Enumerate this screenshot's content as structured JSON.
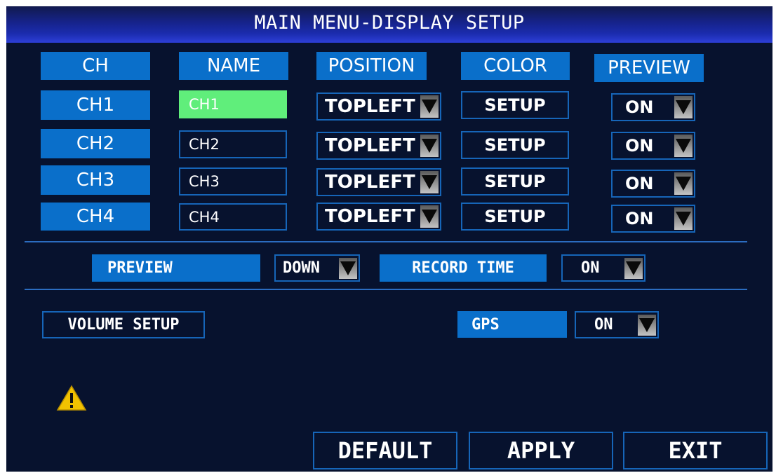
{
  "title": "MAIN MENU-DISPLAY SETUP",
  "headers": {
    "ch": "CH",
    "name": "NAME",
    "position": "POSITION",
    "color": "COLOR",
    "preview": "PREVIEW"
  },
  "channels": [
    {
      "label": "CH1",
      "name": "CH1",
      "position": "TOPLEFT",
      "color": "SETUP",
      "preview": "ON"
    },
    {
      "label": "CH2",
      "name": "CH2",
      "position": "TOPLEFT",
      "color": "SETUP",
      "preview": "ON"
    },
    {
      "label": "CH3",
      "name": "CH3",
      "position": "TOPLEFT",
      "color": "SETUP",
      "preview": "ON"
    },
    {
      "label": "CH4",
      "name": "CH4",
      "position": "TOPLEFT",
      "color": "SETUP",
      "preview": "ON"
    }
  ],
  "preview_row": {
    "preview_label": "PREVIEW",
    "preview_value": "DOWN",
    "record_time_label": "RECORD TIME",
    "record_time_value": "ON"
  },
  "volume_setup": "VOLUME SETUP",
  "gps": {
    "label": "GPS",
    "value": "ON"
  },
  "buttons": {
    "default": "DEFAULT",
    "apply": "APPLY",
    "exit": "EXIT"
  },
  "icons": {
    "warning": "warning-icon",
    "dropdown_arrow": "chevron-down-icon"
  },
  "colors": {
    "background": "#07122e",
    "header_blue": "#0a6fca",
    "border_blue": "#1665b8",
    "active_green": "#60ee7b",
    "warning_yellow": "#f2c200"
  }
}
